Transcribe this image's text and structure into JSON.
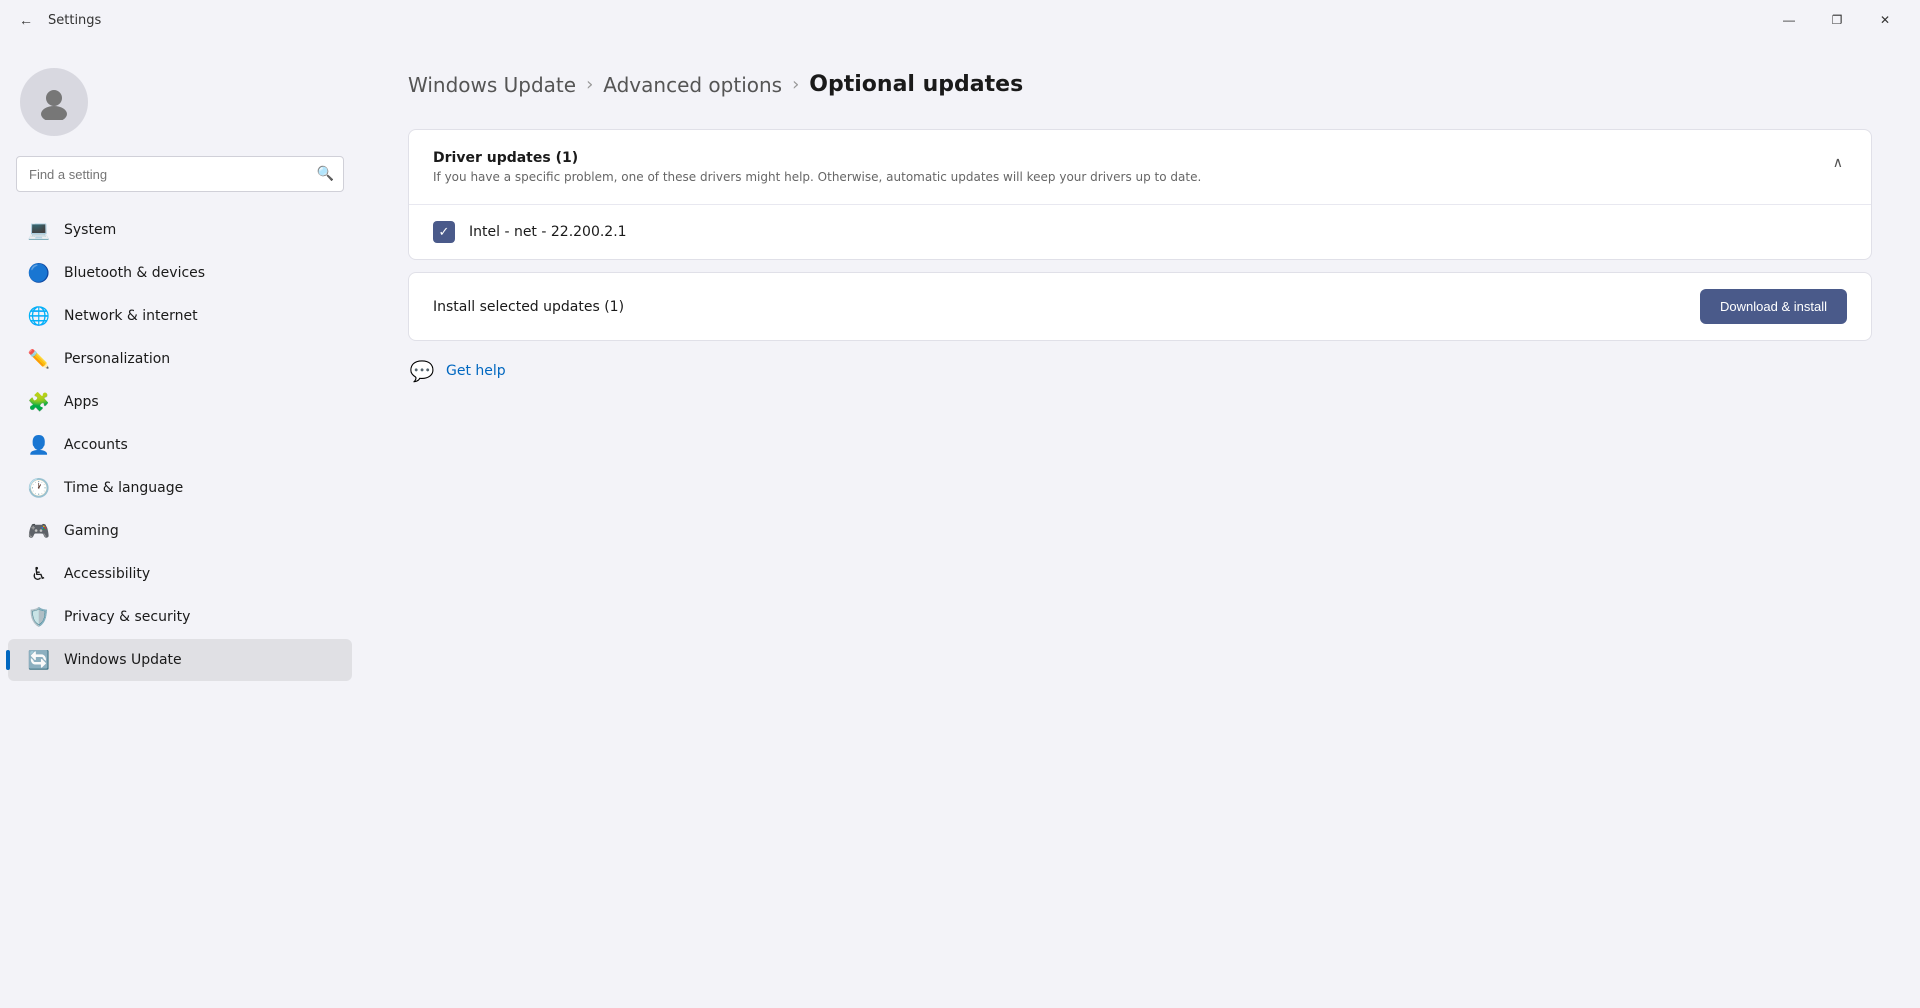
{
  "titlebar": {
    "title": "Settings",
    "back_label": "←",
    "minimize": "—",
    "maximize": "❐",
    "close": "✕"
  },
  "sidebar": {
    "search_placeholder": "Find a setting",
    "nav_items": [
      {
        "id": "system",
        "label": "System",
        "icon": "💻",
        "active": false
      },
      {
        "id": "bluetooth",
        "label": "Bluetooth & devices",
        "icon": "🔵",
        "active": false
      },
      {
        "id": "network",
        "label": "Network & internet",
        "icon": "🌐",
        "active": false
      },
      {
        "id": "personalization",
        "label": "Personalization",
        "icon": "✏️",
        "active": false
      },
      {
        "id": "apps",
        "label": "Apps",
        "icon": "🧩",
        "active": false
      },
      {
        "id": "accounts",
        "label": "Accounts",
        "icon": "👤",
        "active": false
      },
      {
        "id": "time",
        "label": "Time & language",
        "icon": "🕐",
        "active": false
      },
      {
        "id": "gaming",
        "label": "Gaming",
        "icon": "🎮",
        "active": false
      },
      {
        "id": "accessibility",
        "label": "Accessibility",
        "icon": "♿",
        "active": false
      },
      {
        "id": "privacy",
        "label": "Privacy & security",
        "icon": "🛡️",
        "active": false
      },
      {
        "id": "windows-update",
        "label": "Windows Update",
        "icon": "🔄",
        "active": true
      }
    ]
  },
  "breadcrumb": {
    "items": [
      {
        "id": "windows-update",
        "label": "Windows Update"
      },
      {
        "id": "advanced-options",
        "label": "Advanced options"
      }
    ],
    "current": "Optional updates",
    "separator": "›"
  },
  "driver_updates": {
    "title": "Driver updates (1)",
    "description": "If you have a specific problem, one of these drivers might help. Otherwise, automatic updates will keep your drivers up to date.",
    "items": [
      {
        "id": "intel-net",
        "label": "Intel - net - 22.200.2.1",
        "checked": true
      }
    ],
    "collapse_icon": "∧"
  },
  "install_section": {
    "label": "Install selected updates (1)",
    "button_label": "Download & install"
  },
  "help": {
    "label": "Get help"
  }
}
